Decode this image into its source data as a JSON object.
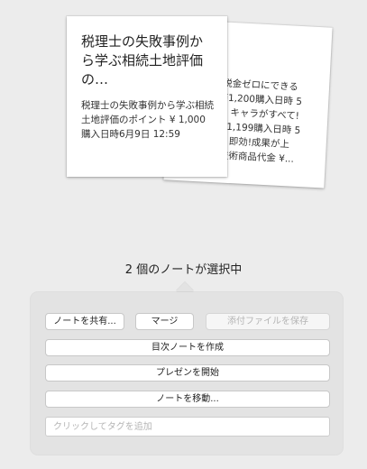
{
  "notes": {
    "front": {
      "title": "税理士の失敗事例から学ぶ相続土地評価の…",
      "body": "税理士の失敗事例から学ぶ相続土地評価のポイント ¥ 1,000購入日時6月9日 12:59"
    },
    "back": {
      "body": "税金ゼロにできる\n¥1,200購入日時 5\n3 キャラがすべて!\n¥1,199購入日時 5\n0 即効!成果が上\n技術商品代金 ¥..."
    }
  },
  "selection": {
    "title": "2 個のノートが選択中"
  },
  "actions": {
    "share_label": "ノートを共有...",
    "merge_label": "マージ",
    "save_attachments_label": "添付ファイルを保存",
    "create_toc_label": "目次ノートを作成",
    "presentation_label": "プレゼンを開始",
    "move_label": "ノートを移動..."
  },
  "tag_input": {
    "placeholder": "クリックしてタグを追加"
  }
}
